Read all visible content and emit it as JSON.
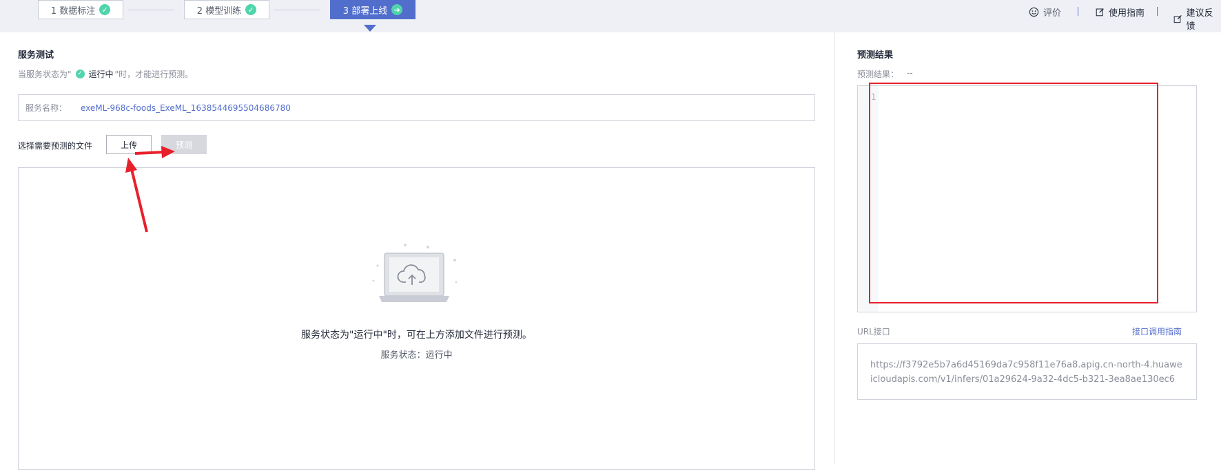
{
  "steps": [
    {
      "label": "1 数据标注",
      "state": "done"
    },
    {
      "label": "2 模型训练",
      "state": "done"
    },
    {
      "label": "3 部署上线",
      "state": "active"
    }
  ],
  "toplinks": {
    "rate": "评价",
    "guide": "使用指南",
    "feedback": "建议反馈"
  },
  "service_test": {
    "title": "服务测试",
    "hint_prefix": "当服务状态为\"",
    "hint_status": "运行中",
    "hint_suffix": "\"时，才能进行预测。",
    "name_label": "服务名称：",
    "name_value": "exeML-968c-foods_ExeML_1638544695504686780",
    "select_label": "选择需要预测的文件",
    "upload_button": "上传",
    "predict_button": "预测",
    "dropzone_message": "服务状态为\"运行中\"时，可在上方添加文件进行预测。",
    "dropzone_status": "服务状态：运行中"
  },
  "result": {
    "title": "预测结果",
    "label": "预测结果：",
    "value": "--",
    "line_number": "1",
    "url_label": "URL接口",
    "url_guide_link": "接口调用指南",
    "url_value": "https://f3792e5b7a6d45169da7c958f11e76a8.apig.cn-north-4.huaweicloudapis.com/v1/infers/01a29624-9a32-4dc5-b321-3ea8ae130ec6"
  },
  "colors": {
    "accent": "#526ecc",
    "success": "#50d4ab",
    "annotation": "#e8202b"
  }
}
